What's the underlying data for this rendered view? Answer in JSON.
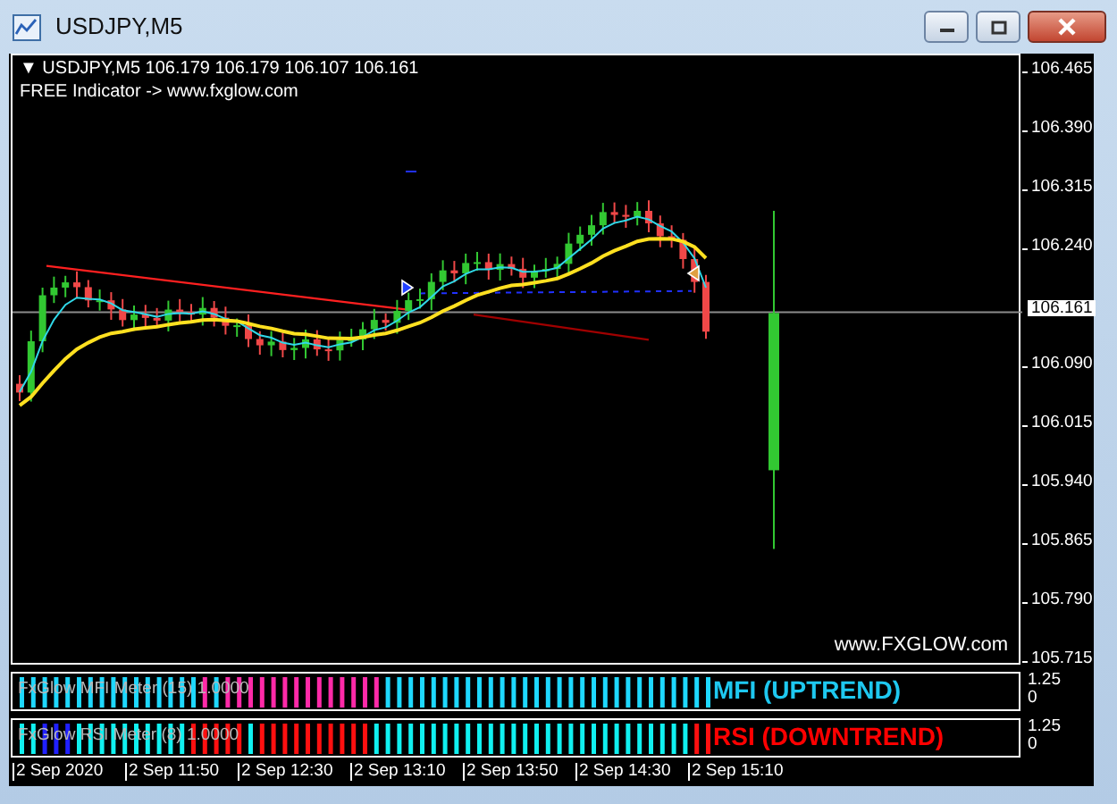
{
  "window": {
    "title": "USDJPY,M5",
    "buttons": [
      {
        "kind": "minimize"
      },
      {
        "kind": "maximize"
      },
      {
        "kind": "close"
      }
    ]
  },
  "chart": {
    "menu_glyph": "▼",
    "header": "USDJPY,M5  106.179 106.179 106.107 106.161",
    "note": "FREE Indicator -> www.fxglow.com",
    "site_label": "www.FXGLOW.com",
    "price_axis": [
      "106.465",
      "106.390",
      "106.315",
      "106.240",
      "106.090",
      "106.015",
      "105.940",
      "105.865",
      "105.790",
      "105.715"
    ],
    "current_price": "106.161"
  },
  "indicators": [
    {
      "label": "FxGlow MFI Meter (15) 1.0000",
      "signal": "MFI (UPTREND)",
      "color": "#1ec8f0",
      "scale_max": "1.25",
      "scale_min": "0"
    },
    {
      "label": "FxGlow RSI Meter (8) 1.0000",
      "signal": "RSI (DOWNTREND)",
      "color": "#ff0000",
      "scale_max": "1.25",
      "scale_min": "0"
    }
  ],
  "time_axis": [
    "2 Sep 2020",
    "2 Sep 11:50",
    "2 Sep 12:30",
    "2 Sep 13:10",
    "2 Sep 13:50",
    "2 Sep 14:30",
    "2 Sep 15:10"
  ]
}
